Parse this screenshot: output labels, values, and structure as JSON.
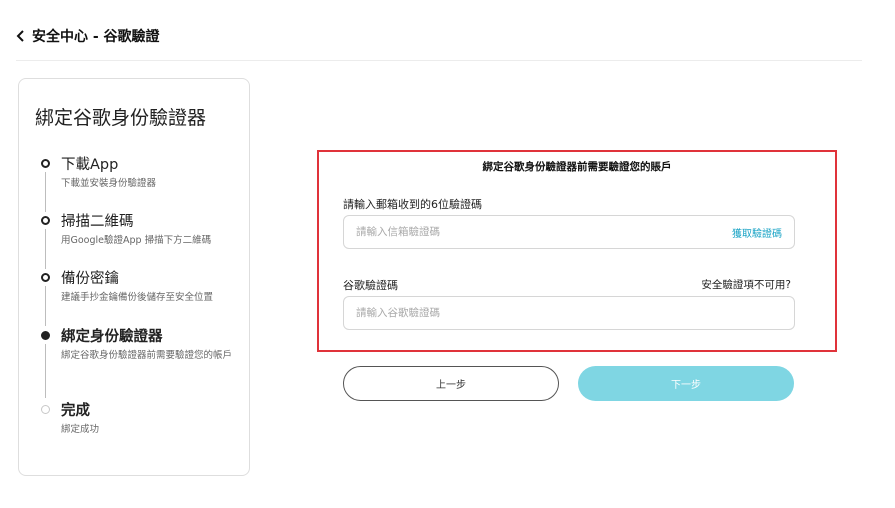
{
  "header": {
    "back_icon": "chevron-left-icon",
    "title": "安全中心 - 谷歌驗證"
  },
  "steps_panel": {
    "title": "綁定谷歌身份驗證器",
    "steps": [
      {
        "title": "下載App",
        "desc": "下載並安裝身份驗證器",
        "state": "done"
      },
      {
        "title": "掃描二維碼",
        "desc": "用Google驗證App 掃描下方二維碼",
        "state": "done"
      },
      {
        "title": "備份密鑰",
        "desc": "建議手抄金鑰備份後儲存至安全位置",
        "state": "done"
      },
      {
        "title": "綁定身份驗證器",
        "desc": "綁定谷歌身份驗證器前需要驗證您的帳戶",
        "state": "active"
      },
      {
        "title": "完成",
        "desc": "綁定成功",
        "state": "pending"
      }
    ]
  },
  "verify": {
    "heading": "綁定谷歌身份驗證器前需要驗證您的賬戶",
    "email_label": "請輸入郵箱收到的6位驗證碼",
    "email_placeholder": "請輸入信箱驗證碼",
    "email_value": "",
    "get_code_label": "獲取驗證碼",
    "google_label": "谷歌驗證碼",
    "unavailable_label": "安全驗證項不可用?",
    "google_placeholder": "請輸入谷歌驗證碼",
    "google_value": ""
  },
  "buttons": {
    "prev_label": "上一步",
    "next_label": "下一步"
  },
  "colors": {
    "highlight_border": "#e0333a",
    "accent_link": "#18a3c5",
    "next_button": "#7fd6e3"
  }
}
